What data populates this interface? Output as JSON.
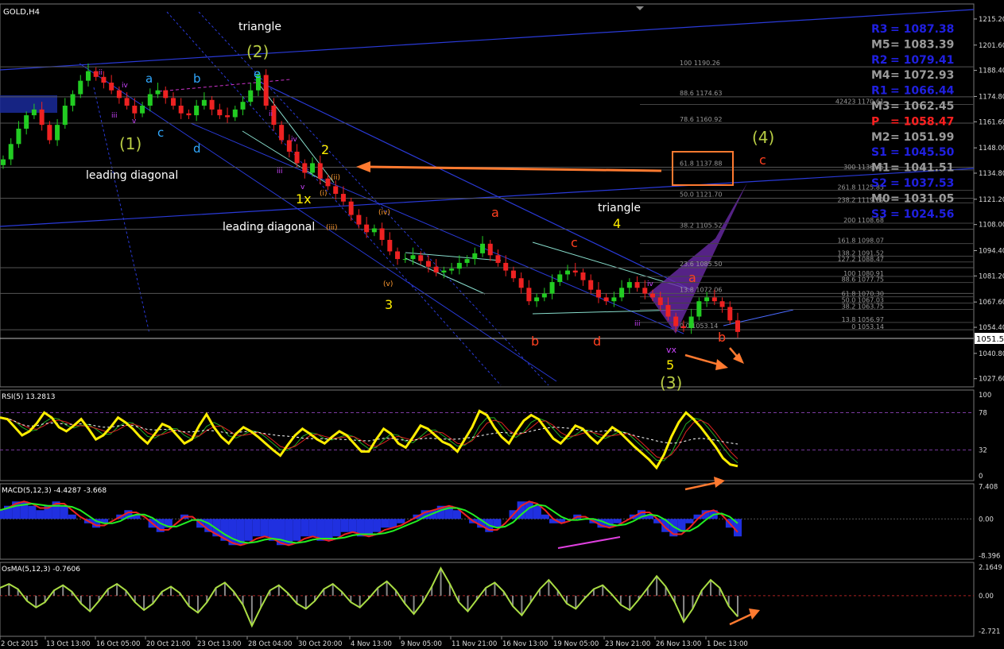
{
  "symbol": "GOLD,H4",
  "chart_data": [
    {
      "type": "candlestick",
      "title": "GOLD,H4",
      "ylim": [
        1025,
        1216
      ],
      "y_ticks": [
        "1215.20",
        "1201.60",
        "1188.40",
        "1174.80",
        "1161.60",
        "1148.00",
        "1134.80",
        "1121.20",
        "1108.00",
        "1094.40",
        "1081.20",
        "1067.60",
        "1054.40",
        "1040.80",
        "1027.60"
      ],
      "current_price": "1051.55",
      "x_labels": [
        "2 Oct 2015",
        "13 Oct 13:00",
        "16 Oct 05:00",
        "20 Oct 21:00",
        "23 Oct 13:00",
        "28 Oct 04:00",
        "30 Oct 20:00",
        "4 Nov 13:00",
        "9 Nov 05:00",
        "11 Nov 21:00",
        "16 Nov 13:00",
        "19 Nov 05:00",
        "23 Nov 21:00",
        "26 Nov 13:00",
        "1 Dec 13:00"
      ],
      "close_path": [
        1142,
        1150,
        1158,
        1165,
        1168,
        1160,
        1152,
        1160,
        1170,
        1176,
        1183,
        1188,
        1185,
        1182,
        1178,
        1174,
        1170,
        1166,
        1170,
        1176,
        1178,
        1174,
        1170,
        1166,
        1165,
        1170,
        1173,
        1168,
        1165,
        1164,
        1168,
        1172,
        1178,
        1186,
        1170,
        1160,
        1152,
        1146,
        1140,
        1135,
        1140,
        1132,
        1128,
        1124,
        1120,
        1113,
        1108,
        1104,
        1106,
        1100,
        1094,
        1090,
        1090,
        1092,
        1089,
        1086,
        1083,
        1084,
        1085,
        1088,
        1090,
        1093,
        1098,
        1092,
        1088,
        1084,
        1080,
        1075,
        1068,
        1070,
        1072,
        1078,
        1082,
        1084,
        1083,
        1079,
        1074,
        1070,
        1068,
        1070,
        1075,
        1078,
        1075,
        1072,
        1070,
        1066,
        1060,
        1055,
        1054,
        1060,
        1068,
        1070,
        1068,
        1065,
        1058,
        1052
      ],
      "pivots": [
        {
          "name": "R3",
          "value": "= 1087.38",
          "color": "#2020e0"
        },
        {
          "name": "M5",
          "value": "= 1083.39",
          "color": "#9a9a9a"
        },
        {
          "name": "R2",
          "value": "= 1079.41",
          "color": "#2020e0"
        },
        {
          "name": "M4",
          "value": "= 1072.93",
          "color": "#9a9a9a"
        },
        {
          "name": "R1",
          "value": "= 1066.44",
          "color": "#2020e0"
        },
        {
          "name": "M3",
          "value": "= 1062.45",
          "color": "#9a9a9a"
        },
        {
          "name": "P",
          "value": "= 1058.47",
          "color": "#ff2020"
        },
        {
          "name": "M2",
          "value": "= 1051.99",
          "color": "#9a9a9a"
        },
        {
          "name": "S1",
          "value": "= 1045.50",
          "color": "#2020e0"
        },
        {
          "name": "M1",
          "value": "= 1041.51",
          "color": "#9a9a9a"
        },
        {
          "name": "S2",
          "value": "= 1037.53",
          "color": "#2020e0"
        },
        {
          "name": "M0",
          "value": "= 1031.05",
          "color": "#9a9a9a"
        },
        {
          "name": "S3",
          "value": "= 1024.56",
          "color": "#2020e0"
        }
      ],
      "fib_levels": [
        {
          "label": "100 1190.26",
          "value": 1190.26
        },
        {
          "label": "88.6 1174.63",
          "value": 1174.63
        },
        {
          "label": "78.6 1160.92",
          "value": 1160.92
        },
        {
          "label": "61.8 1137.88",
          "value": 1137.88
        },
        {
          "label": "50.0 1121.70",
          "value": 1121.7
        },
        {
          "label": "38.2 1105.52",
          "value": 1105.52
        },
        {
          "label": "23.6 1085.50",
          "value": 1085.5
        },
        {
          "label": "13.8 1072.06",
          "value": 1072.06
        },
        {
          "label": "0.0 1053.14",
          "value": 1053.14
        }
      ],
      "ext_levels": [
        {
          "label": "42423 1170.61",
          "value": 1170.61
        },
        {
          "label": "300 1136.45",
          "value": 1136.45
        },
        {
          "label": "261.8 1125.85",
          "value": 1125.85
        },
        {
          "label": "238.2 1119.29",
          "value": 1119.29
        },
        {
          "label": "200 1108.68",
          "value": 1108.68
        },
        {
          "label": "161.8 1098.07",
          "value": 1098.07
        },
        {
          "label": "138.2 1091.52",
          "value": 1091.52
        },
        {
          "label": "127.2 1088.47",
          "value": 1088.47
        },
        {
          "label": "100 1080.91",
          "value": 1080.91
        },
        {
          "label": "88.6 1077.75",
          "value": 1077.75
        },
        {
          "label": "61.8 1070.30",
          "value": 1070.3
        },
        {
          "label": "50.0 1067.03",
          "value": 1067.03
        },
        {
          "label": "38.2 1063.75",
          "value": 1063.75
        },
        {
          "label": "13.8 1056.97",
          "value": 1056.97
        },
        {
          "label": "0 1053.14",
          "value": 1053.14
        }
      ],
      "annotations": [
        {
          "text": "triangle",
          "color": "#ffffff"
        },
        {
          "text": "(2)",
          "color": "#b8cc44"
        },
        {
          "text": "(1)",
          "color": "#b8cc44"
        },
        {
          "text": "leading diagonal",
          "color": "#ffffff"
        },
        {
          "text": "leading diagonal",
          "color": "#ffffff"
        },
        {
          "text": "triangle",
          "color": "#ffffff"
        },
        {
          "text": "(4)",
          "color": "#b8cc44"
        },
        {
          "text": "(3)",
          "color": "#b8cc44"
        },
        {
          "text": "2",
          "color": "#ffee00"
        },
        {
          "text": "1x",
          "color": "#ffee00"
        },
        {
          "text": "3",
          "color": "#ffee00"
        },
        {
          "text": "4",
          "color": "#ffee00"
        },
        {
          "text": "5",
          "color": "#ffee00"
        },
        {
          "text": "a",
          "color": "#ff4020"
        },
        {
          "text": "b",
          "color": "#ff4020"
        },
        {
          "text": "c",
          "color": "#ff4020"
        },
        {
          "text": "d",
          "color": "#ff4020"
        },
        {
          "text": "a",
          "color": "#ff4020"
        },
        {
          "text": "b",
          "color": "#ff4020"
        },
        {
          "text": "c",
          "color": "#ff4020"
        },
        {
          "text": "a",
          "color": "#30a8ff"
        },
        {
          "text": "b",
          "color": "#30a8ff"
        },
        {
          "text": "c",
          "color": "#30a8ff"
        },
        {
          "text": "d",
          "color": "#30a8ff"
        },
        {
          "text": "e",
          "color": "#30a8ff"
        },
        {
          "text": "vx",
          "color": "#cc44ff"
        }
      ]
    },
    {
      "type": "line",
      "title": "RSI(5) 13.2813",
      "ylim": [
        0,
        100
      ],
      "y_ticks": [
        "100",
        "78",
        "32",
        "0"
      ],
      "levels": [
        78,
        32
      ],
      "values": [
        72,
        70,
        60,
        50,
        55,
        65,
        78,
        72,
        60,
        55,
        62,
        70,
        58,
        45,
        50,
        60,
        72,
        66,
        58,
        48,
        40,
        52,
        64,
        60,
        50,
        40,
        45,
        62,
        76,
        60,
        48,
        40,
        52,
        60,
        55,
        48,
        40,
        32,
        25,
        38,
        50,
        58,
        52,
        45,
        40,
        48,
        55,
        50,
        40,
        30,
        30,
        45,
        58,
        52,
        40,
        35,
        48,
        62,
        58,
        50,
        42,
        38,
        30,
        45,
        60,
        80,
        75,
        60,
        48,
        40,
        55,
        68,
        75,
        70,
        58,
        46,
        40,
        50,
        62,
        58,
        48,
        40,
        50,
        60,
        54,
        45,
        36,
        28,
        20,
        10,
        26,
        48,
        66,
        78,
        70,
        60,
        48,
        36,
        22,
        14,
        12
      ]
    },
    {
      "type": "line",
      "title": "MACD(5,12,3) -4.4287 -3.668",
      "ylim": [
        -8.5,
        7.5
      ],
      "y_ticks": [
        "7.408",
        "0.00",
        "-8.396"
      ],
      "values": [
        2,
        3,
        4,
        4,
        3,
        2,
        3,
        4,
        3,
        1,
        0,
        -1,
        -2,
        -1,
        0,
        1,
        2,
        1,
        0,
        -2,
        -3,
        -2,
        0,
        1,
        0,
        -2,
        -3,
        -4,
        -5,
        -6,
        -6,
        -5,
        -4,
        -4,
        -5,
        -6,
        -6,
        -5,
        -4,
        -4,
        -5,
        -5,
        -4,
        -3,
        -3,
        -4,
        -4,
        -3,
        -2,
        -2,
        -1,
        0,
        1,
        2,
        2,
        3,
        3,
        2,
        0,
        -1,
        -2,
        -3,
        -2,
        0,
        2,
        4,
        4,
        3,
        1,
        -1,
        -1,
        0,
        1,
        0,
        -1,
        -2,
        -2,
        -1,
        0,
        1,
        2,
        1,
        -1,
        -3,
        -4,
        -3,
        -1,
        1,
        2,
        2,
        0,
        -2,
        -4
      ]
    },
    {
      "type": "bar",
      "title": "OsMA(5,12,3) -0.7606",
      "ylim": [
        -2.8,
        2.3
      ],
      "y_ticks": [
        "2.1649",
        "0.00",
        "-2.721"
      ],
      "values": [
        0.6,
        0.9,
        0.5,
        -0.4,
        -0.9,
        -0.5,
        0.4,
        0.8,
        0.3,
        -0.6,
        -1.2,
        -0.4,
        0.5,
        0.9,
        0.4,
        -0.5,
        -1.1,
        -0.6,
        0.3,
        0.7,
        0.2,
        -0.8,
        -1.3,
        -0.5,
        0.6,
        1.0,
        0.3,
        -0.7,
        -2.3,
        -0.9,
        0.4,
        0.8,
        0.2,
        -0.6,
        -1.0,
        -0.4,
        0.5,
        0.9,
        0.3,
        -0.5,
        -0.9,
        -0.2,
        0.6,
        1.1,
        0.4,
        -0.6,
        -1.4,
        -0.5,
        0.7,
        2.1,
        0.9,
        -0.5,
        -1.2,
        -0.3,
        0.6,
        1.0,
        0.3,
        -0.8,
        -1.5,
        -0.5,
        0.5,
        1.2,
        0.4,
        -0.6,
        -1.0,
        -0.2,
        0.5,
        0.8,
        0.1,
        -0.7,
        -1.1,
        -0.3,
        0.6,
        1.5,
        0.7,
        -0.5,
        -2.0,
        -1.0,
        0.4,
        1.2,
        0.6,
        -0.8,
        -1.6
      ]
    }
  ]
}
